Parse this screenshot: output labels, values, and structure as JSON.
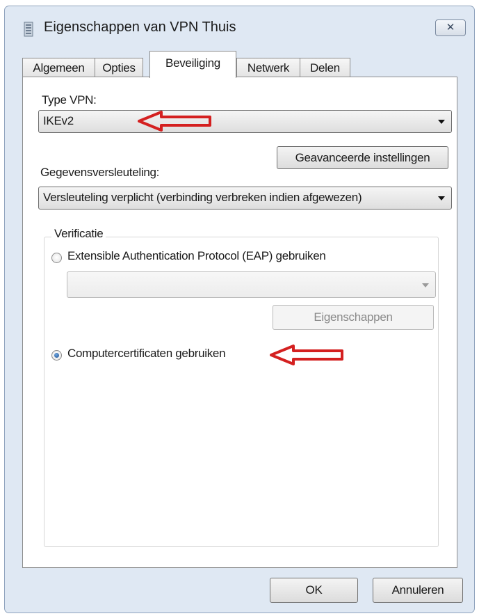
{
  "window": {
    "title": "Eigenschappen van VPN Thuis",
    "close_label": "✕"
  },
  "tabs": [
    {
      "label": "Algemeen",
      "active": false
    },
    {
      "label": "Opties",
      "active": false
    },
    {
      "label": "Beveiliging",
      "active": true
    },
    {
      "label": "Netwerk",
      "active": false
    },
    {
      "label": "Delen",
      "active": false
    }
  ],
  "security": {
    "vpn_type_label": "Type VPN:",
    "vpn_type_value": "IKEv2",
    "advanced_button": "Geavanceerde instellingen",
    "encryption_label": "Gegevensversleuteling:",
    "encryption_value": "Versleuteling verplicht (verbinding verbreken indien afgewezen)"
  },
  "verification": {
    "group_label": "Verificatie",
    "eap_option": {
      "label": "Extensible Authentication Protocol (EAP) gebruiken",
      "checked": false
    },
    "eap_select_value": "",
    "properties_button": "Eigenschappen",
    "cert_option": {
      "label": "Computercertificaten gebruiken",
      "checked": true
    }
  },
  "footer": {
    "ok_label": "OK",
    "cancel_label": "Annuleren"
  },
  "annotations": {
    "arrow_color": "#d42020"
  },
  "icons": {
    "title_icon": "vpn-connection-icon",
    "close_icon": "close-icon",
    "dropdown_icon": "chevron-down-icon"
  }
}
